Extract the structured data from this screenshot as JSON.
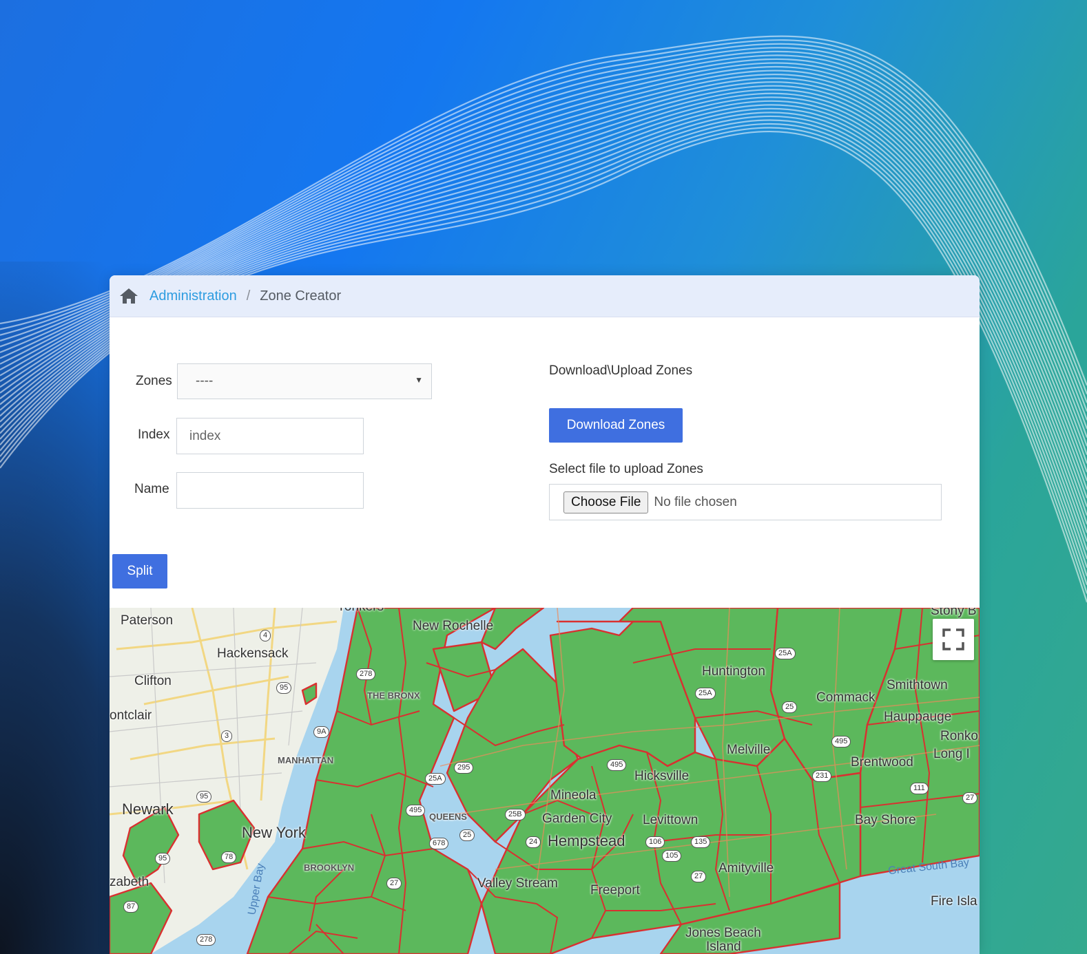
{
  "breadcrumb": {
    "home_icon": "home-icon",
    "parent": "Administration",
    "separator": "/",
    "current": "Zone Creator"
  },
  "form": {
    "zones_label": "Zones",
    "zones_value": "----",
    "index_label": "Index",
    "index_placeholder": "index",
    "name_label": "Name",
    "name_value": "",
    "split_label": "Split"
  },
  "transfer": {
    "heading": "Download\\Upload Zones",
    "download_label": "Download Zones",
    "upload_label": "Select file to upload Zones",
    "choose_file_label": "Choose File",
    "no_file_text": "No file chosen"
  },
  "map": {
    "fullscreen_icon": "fullscreen-icon",
    "places": {
      "yonkers": "Yonkers",
      "paterson": "Paterson",
      "new_rochelle": "New Rochelle",
      "stony_brook": "Stony B",
      "hackensack": "Hackensack",
      "clifton": "Clifton",
      "montclair": "ontclair",
      "the_bronx": "THE BRONX",
      "huntington": "Huntington",
      "smithtown": "Smithtown",
      "commack": "Commack",
      "hauppauge": "Hauppauge",
      "ronkonkoma": "Ronko",
      "long_island": "Long I",
      "melville": "Melville",
      "brentwood": "Brentwood",
      "manhattan": "MANHATTAN",
      "hicksville": "Hicksville",
      "mineola": "Mineola",
      "queens": "QUEENS",
      "newark": "Newark",
      "new_york": "New York",
      "garden_city": "Garden City",
      "levittown": "Levittown",
      "hempstead": "Hempstead",
      "bay_shore": "Bay Shore",
      "great_south_bay": "Great South Bay",
      "elizabeth": "zabeth",
      "brooklyn": "BROOKLYN",
      "valley_stream": "Valley Stream",
      "freeport": "Freeport",
      "amityville": "Amityville",
      "fire_island": "Fire Isla",
      "upper_bay": "Upper Bay",
      "jones_beach": "Jones Beach",
      "jones_beach_2": "Island"
    },
    "shields": [
      "4",
      "95",
      "3",
      "95",
      "95",
      "78",
      "278",
      "87",
      "278",
      "9A",
      "295",
      "25A",
      "495",
      "678",
      "25",
      "25B",
      "24",
      "495",
      "25A",
      "25A",
      "25",
      "106",
      "105",
      "135",
      "27",
      "495",
      "231",
      "111",
      "27",
      "27"
    ],
    "colors": {
      "zone_fill": "#5cb85c",
      "zone_stroke": "#d93030",
      "water": "#a8d4ee",
      "land": "#eef0e8"
    }
  }
}
